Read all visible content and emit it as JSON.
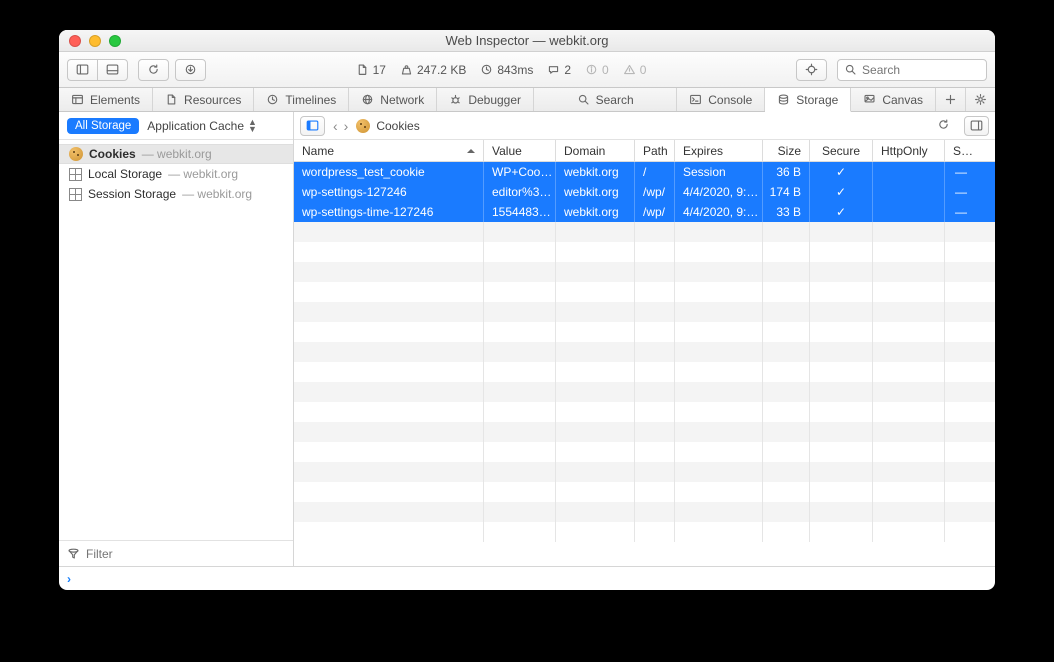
{
  "window": {
    "title": "Web Inspector — webkit.org"
  },
  "toolbar": {
    "doc_count": "17",
    "transfer_size": "247.2 KB",
    "load_time": "843ms",
    "log_count": "2",
    "info_count": "0",
    "warn_count": "0",
    "search_placeholder": "Search"
  },
  "tabs": [
    {
      "id": "elements",
      "label": "Elements"
    },
    {
      "id": "resources",
      "label": "Resources"
    },
    {
      "id": "timelines",
      "label": "Timelines"
    },
    {
      "id": "network",
      "label": "Network"
    },
    {
      "id": "debugger",
      "label": "Debugger"
    },
    {
      "id": "search",
      "label": "Search"
    },
    {
      "id": "console",
      "label": "Console"
    },
    {
      "id": "storage",
      "label": "Storage",
      "active": true
    },
    {
      "id": "canvas",
      "label": "Canvas"
    }
  ],
  "sidebar": {
    "scope_label": "All Storage",
    "filter_select": "Application Cache",
    "items": [
      {
        "kind": "cookies",
        "label": "Cookies",
        "sub": "webkit.org",
        "active": true
      },
      {
        "kind": "local",
        "label": "Local Storage",
        "sub": "webkit.org"
      },
      {
        "kind": "session",
        "label": "Session Storage",
        "sub": "webkit.org"
      }
    ],
    "filter_placeholder": "Filter"
  },
  "crumb": {
    "label": "Cookies"
  },
  "table": {
    "columns": [
      {
        "key": "name",
        "label": "Name",
        "sort": true
      },
      {
        "key": "value",
        "label": "Value"
      },
      {
        "key": "domain",
        "label": "Domain"
      },
      {
        "key": "path",
        "label": "Path"
      },
      {
        "key": "expires",
        "label": "Expires"
      },
      {
        "key": "size",
        "label": "Size"
      },
      {
        "key": "secure",
        "label": "Secure"
      },
      {
        "key": "httponly",
        "label": "HttpOnly"
      },
      {
        "key": "s",
        "label": "S…"
      }
    ],
    "rows": [
      {
        "name": "wordpress_test_cookie",
        "value": "WP+Coo…",
        "domain": "webkit.org",
        "path": "/",
        "expires": "Session",
        "size": "36 B",
        "secure": "✓",
        "httponly": "",
        "s": "—",
        "selected": true
      },
      {
        "name": "wp-settings-127246",
        "value": "editor%3…",
        "domain": "webkit.org",
        "path": "/wp/",
        "expires": "4/4/2020, 9:…",
        "size": "174 B",
        "secure": "✓",
        "httponly": "",
        "s": "—",
        "selected": true
      },
      {
        "name": "wp-settings-time-127246",
        "value": "1554483…",
        "domain": "webkit.org",
        "path": "/wp/",
        "expires": "4/4/2020, 9:…",
        "size": "33 B",
        "secure": "✓",
        "httponly": "",
        "s": "—",
        "selected": true
      }
    ],
    "blank_rows": 16
  }
}
